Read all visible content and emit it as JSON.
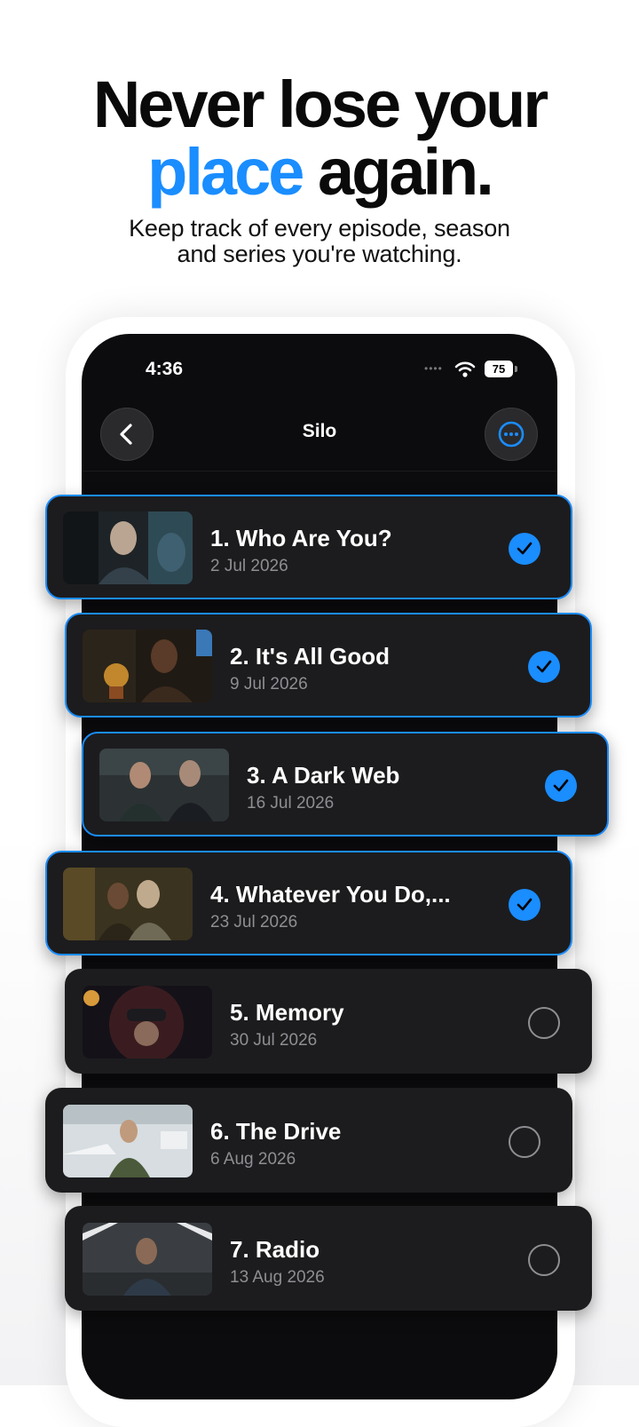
{
  "headline": {
    "line1": "Never lose your",
    "accent_word": "place",
    "line2_rest": " again."
  },
  "subhead": {
    "line1": "Keep track of every episode, season",
    "line2": "and series you're watching."
  },
  "status_bar": {
    "time": "4:36",
    "battery": "75"
  },
  "nav": {
    "title": "Silo",
    "back_icon": "chevron-left-icon",
    "more_icon": "ellipsis-circle-icon"
  },
  "colors": {
    "accent": "#1a8dff",
    "card_bg": "#1c1c1e",
    "screen_bg": "#0c0c0e",
    "secondary_text": "#8e8e93"
  },
  "episodes": [
    {
      "title": "1. Who Are You?",
      "date": "2 Jul 2026",
      "watched": true
    },
    {
      "title": "2. It's All Good",
      "date": "9 Jul 2026",
      "watched": true
    },
    {
      "title": "3. A Dark Web",
      "date": "16 Jul 2026",
      "watched": true
    },
    {
      "title": "4. Whatever You Do,...",
      "date": "23 Jul 2026",
      "watched": true
    },
    {
      "title": "5. Memory",
      "date": "30 Jul 2026",
      "watched": false
    },
    {
      "title": "6. The Drive",
      "date": "6 Aug 2026",
      "watched": false
    },
    {
      "title": "7. Radio",
      "date": "13 Aug 2026",
      "watched": false
    }
  ]
}
